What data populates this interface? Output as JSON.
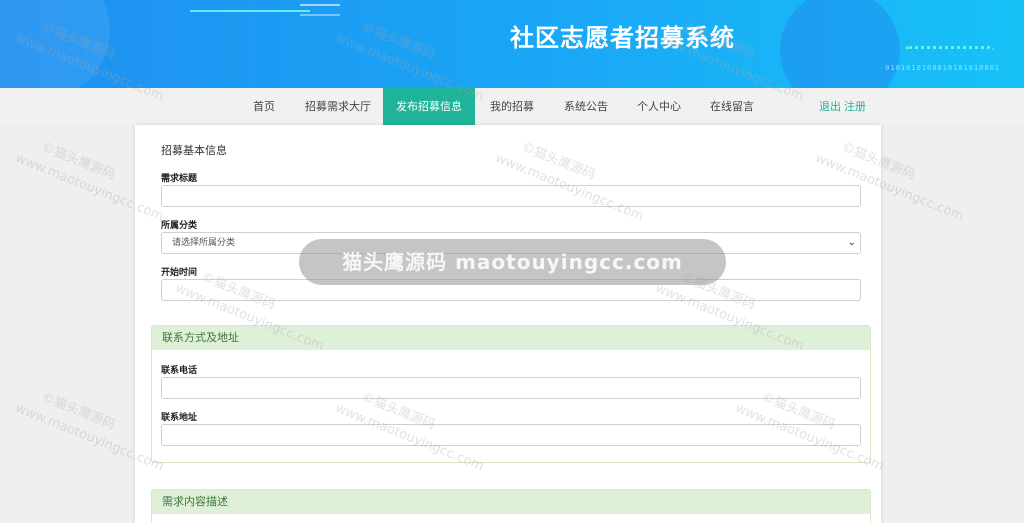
{
  "site": {
    "title": "社区志愿者招募系统",
    "binary_deco": "0101010100010101010001"
  },
  "nav": {
    "items": [
      {
        "label": "首页",
        "active": false
      },
      {
        "label": "招募需求大厅",
        "active": false
      },
      {
        "label": "发布招募信息",
        "active": true
      },
      {
        "label": "我的招募",
        "active": false
      },
      {
        "label": "系统公告",
        "active": false
      },
      {
        "label": "个人中心",
        "active": false
      },
      {
        "label": "在线留言",
        "active": false
      }
    ],
    "logout": "退出",
    "register": "注册"
  },
  "form": {
    "basic_title": "招募基本信息",
    "fields": {
      "title_label": "需求标题",
      "category_label": "所属分类",
      "category_placeholder": "请选择所属分类",
      "start_time_label": "开始时间"
    },
    "contact_panel": {
      "heading": "联系方式及地址",
      "phone_label": "联系电话",
      "address_label": "联系地址"
    },
    "description_panel": {
      "heading": "需求内容描述"
    }
  },
  "watermark": {
    "banner": "猫头鹰源码 maotouyingcc.com",
    "line1": "©猫头鹰源码",
    "line2": "www.maotouyingcc.com"
  },
  "colors": {
    "accent": "#1fb39a",
    "panel_header": "#dff0d8",
    "banner_start": "#1f8ff0",
    "banner_end": "#17c2f7"
  }
}
